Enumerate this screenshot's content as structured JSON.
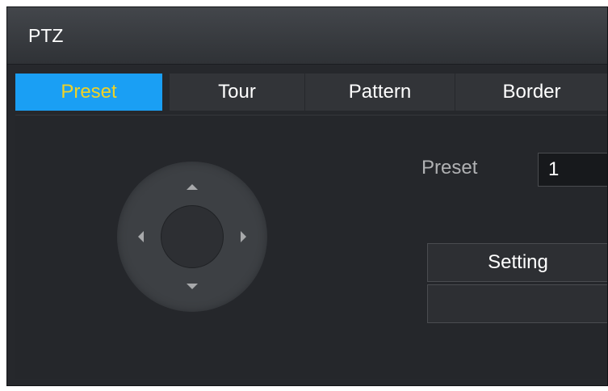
{
  "window": {
    "title": "PTZ"
  },
  "tabs": [
    {
      "label": "Preset",
      "active": true
    },
    {
      "label": "Tour",
      "active": false
    },
    {
      "label": "Pattern",
      "active": false
    },
    {
      "label": "Border",
      "active": false
    }
  ],
  "preset": {
    "label": "Preset",
    "value": "1",
    "setting_button": "Setting",
    "secondary_button": ""
  },
  "ptz_control": {
    "icons": [
      "arrow-up-icon",
      "arrow-down-icon",
      "arrow-left-icon",
      "arrow-right-icon"
    ]
  },
  "colors": {
    "active_tab_bg": "#1a9ff4",
    "active_tab_text": "#f0d225",
    "panel_bg": "#26282c"
  }
}
